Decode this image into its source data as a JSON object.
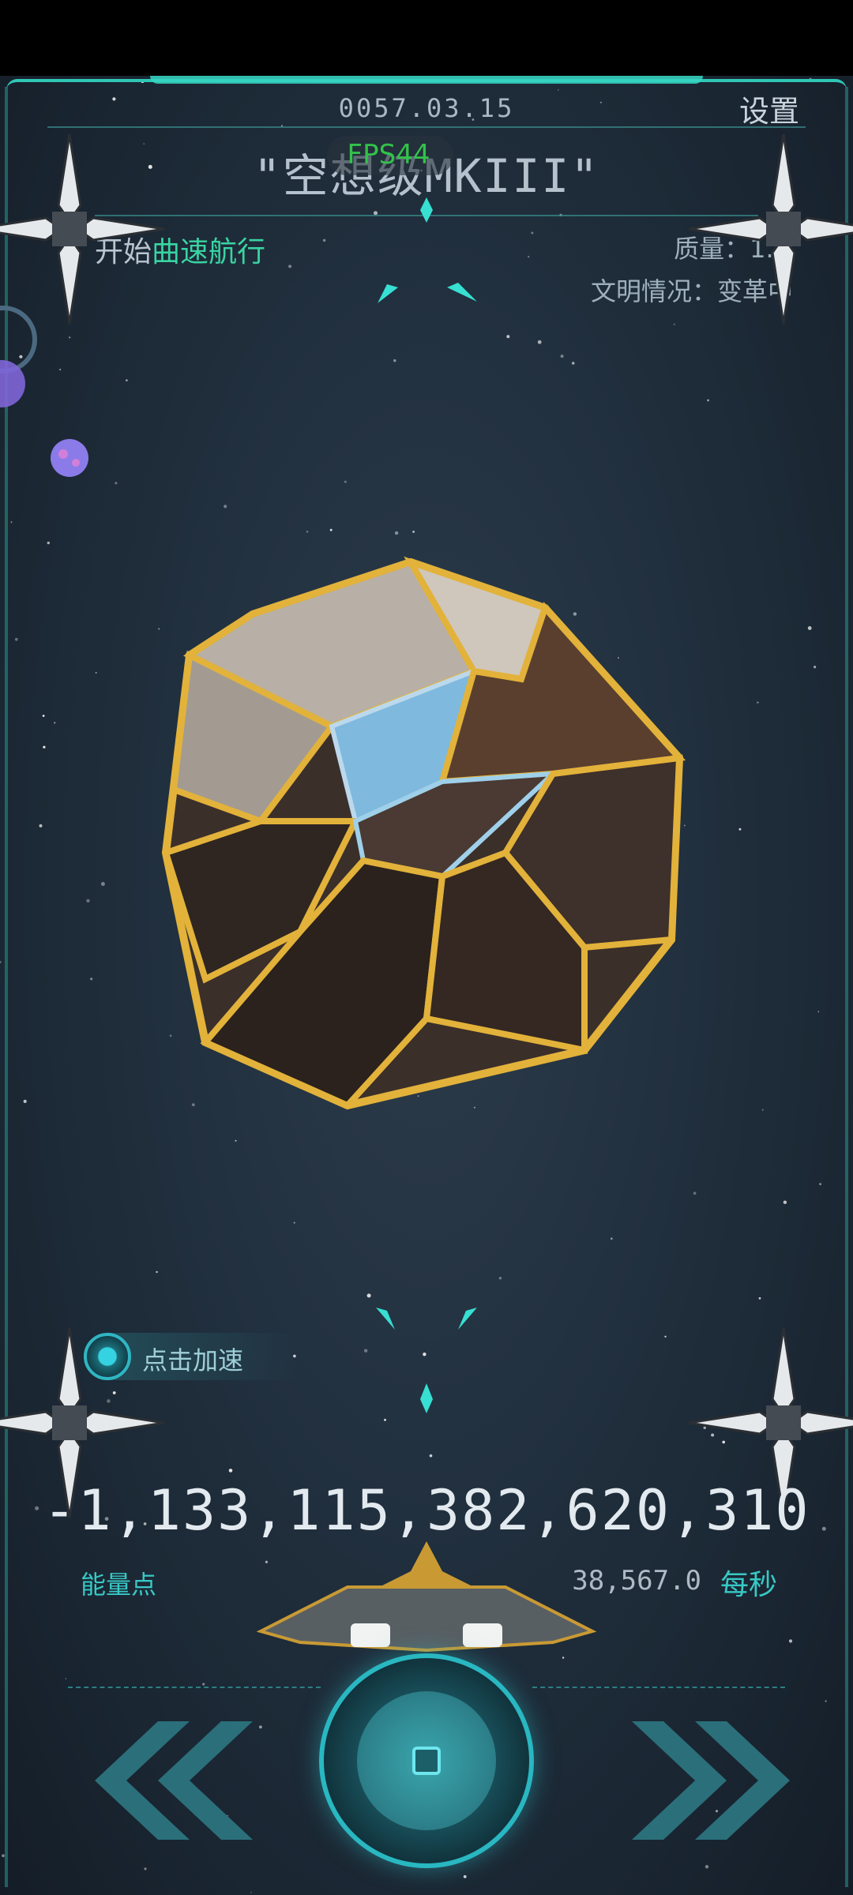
{
  "hud": {
    "date": "0057.03.15",
    "settings_label": "设置",
    "ship_name": "\"空想级MKIII\"",
    "fps": "FPS44",
    "warp_prefix": "开始",
    "warp_action": "曲速航行",
    "mass": "质量：1.2",
    "civilization": "文明情况：变革中"
  },
  "controls": {
    "speed_label": "点击加速"
  },
  "energy": {
    "value": "-1,133,115,382,620,310",
    "label": "能量点",
    "rate_value": "38,567.0",
    "rate_unit": "每秒"
  },
  "colors": {
    "accent": "#2fc7b6",
    "warp_green": "#39d4a2",
    "fps_green": "#33c24a",
    "gold": "#e2b23a"
  },
  "icons": {
    "left": "double-chevron-left-icon",
    "right": "double-chevron-right-icon",
    "main": "engine-core-icon",
    "speed": "boost-icon"
  }
}
